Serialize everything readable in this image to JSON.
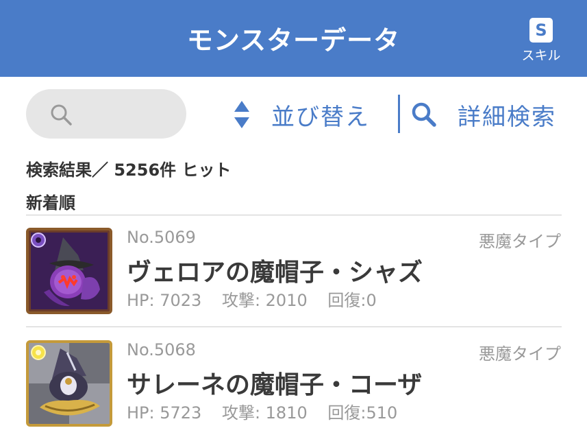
{
  "header": {
    "title": "モンスターデータ",
    "skill_icon_letter": "S",
    "skill_label": "スキル"
  },
  "search": {
    "placeholder": "",
    "value": ""
  },
  "toolbar": {
    "sort_label": "並び替え",
    "detail_search_label": "詳細検索"
  },
  "results": {
    "count_text": "検索結果／ 5256件 ヒット",
    "order_label": "新着順"
  },
  "monsters": [
    {
      "no": "No.5069",
      "type": "悪魔タイプ",
      "name": "ヴェロアの魔帽子・シャズ",
      "hp": "HP: 7023",
      "atk": "攻撃: 2010",
      "rcv": "回復:0",
      "icon": "dark-witch-hat-monster-icon"
    },
    {
      "no": "No.5068",
      "type": "悪魔タイプ",
      "name": "サレーネの魔帽子・コーザ",
      "hp": "HP: 5723",
      "atk": "攻撃: 1810",
      "rcv": "回復:510",
      "icon": "light-witch-hat-monster-icon"
    }
  ],
  "colors": {
    "header": "#4a7cc8",
    "accent": "#4a7cc8",
    "muted_text": "#999999"
  }
}
